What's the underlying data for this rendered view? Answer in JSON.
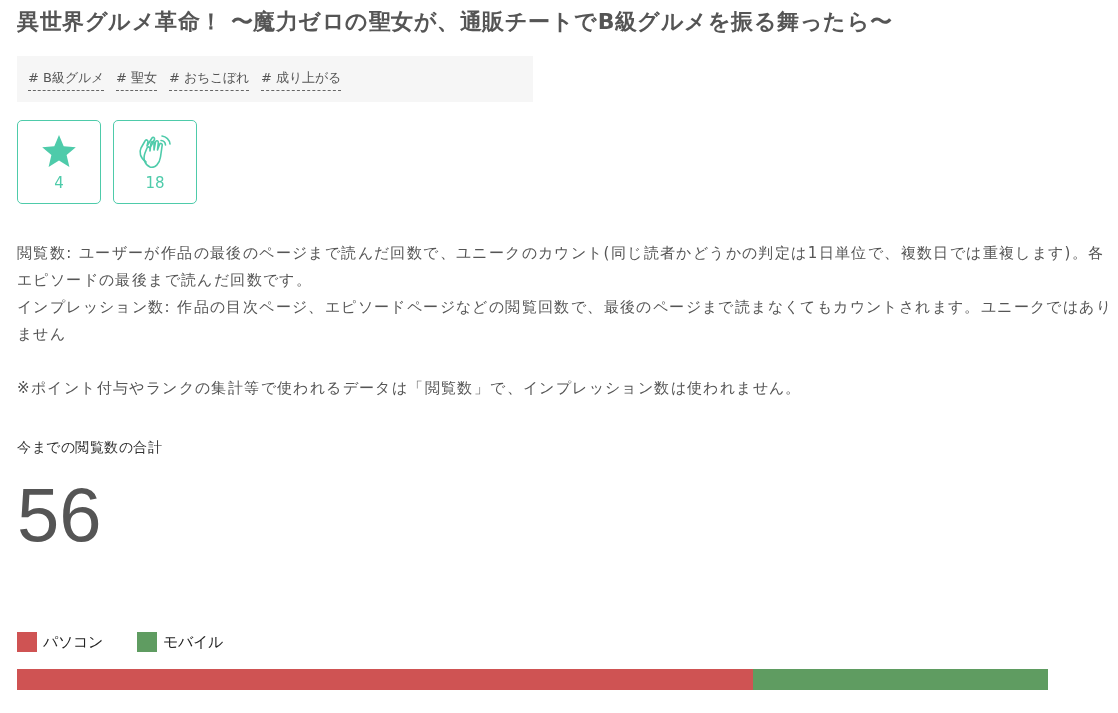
{
  "title": "異世界グルメ革命！ 〜魔力ゼロの聖女が、通販チートでB級グルメを振る舞ったら〜",
  "tags": [
    "# B級グルメ",
    "# 聖女",
    "# おちこぼれ",
    "# 成り上がる"
  ],
  "reactions": [
    {
      "kind": "star",
      "count": "4"
    },
    {
      "kind": "clap",
      "count": "18"
    }
  ],
  "notes": [
    "閲覧数: ユーザーが作品の最後のページまで読んだ回数で、ユニークのカウント(同じ読者かどうかの判定は1日単位で、複数日では重複します)。各エピソードの最後まで読んだ回数です。",
    "インプレッション数: 作品の目次ページ、エピソードページなどの閲覧回数で、最後のページまで読まなくてもカウントされます。ユニークではありません"
  ],
  "footnote": "※ポイント付与やランクの集計等で使われるデータは「閲覧数」で、インプレッション数は使われません。",
  "total": {
    "label": "今までの閲覧数の合計",
    "value": "56"
  },
  "device_breakdown": {
    "segments": [
      {
        "label": "パソコン",
        "color": "#cf5353",
        "level": 0.714
      },
      {
        "label": "モバイル",
        "color": "#5f9c61",
        "level": 0.286
      }
    ]
  }
}
